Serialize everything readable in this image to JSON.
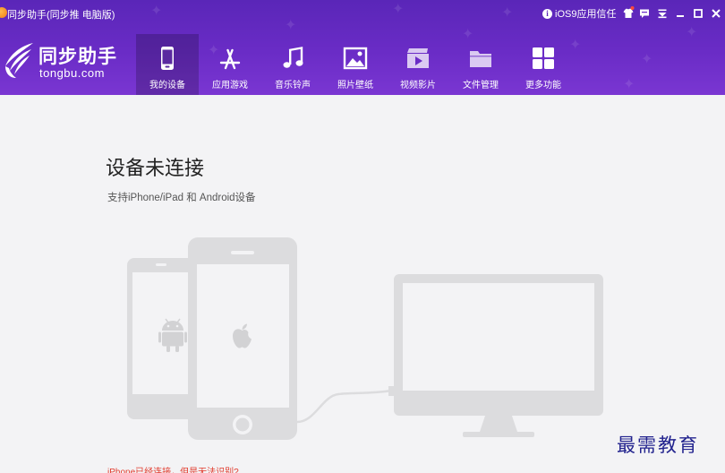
{
  "window": {
    "title": "同步助手(同步推 电脑版)",
    "ios9_trust_label": "iOS9应用信任"
  },
  "window_controls": [
    {
      "name": "skin-icon"
    },
    {
      "name": "feedback-icon"
    },
    {
      "name": "menu-dropdown-icon"
    },
    {
      "name": "minimize-icon"
    },
    {
      "name": "maximize-icon"
    },
    {
      "name": "close-icon"
    }
  ],
  "brand": {
    "name_cn": "同步助手",
    "name_en": "tongbu.com"
  },
  "nav": {
    "items": [
      {
        "label": "我的设备",
        "icon": "phone-icon",
        "active": true
      },
      {
        "label": "应用游戏",
        "icon": "app-store-icon",
        "active": false
      },
      {
        "label": "音乐铃声",
        "icon": "music-note-icon",
        "active": false
      },
      {
        "label": "照片壁纸",
        "icon": "photo-icon",
        "active": false
      },
      {
        "label": "视频影片",
        "icon": "video-icon",
        "active": false
      },
      {
        "label": "文件管理",
        "icon": "folder-icon",
        "active": false
      },
      {
        "label": "更多功能",
        "icon": "grid-icon",
        "active": false
      }
    ]
  },
  "main": {
    "heading": "设备未连接",
    "subheading": "支持iPhone/iPad 和 Android设备",
    "help_link": "iPhone已经连接，但是无法识别?"
  },
  "watermark": "最需教育",
  "colors": {
    "header": "#6a2cc6",
    "nav_active": "#4e1f9e",
    "illustration": "#dcdcde",
    "link": "#e23a2c",
    "watermark": "#22238e"
  }
}
